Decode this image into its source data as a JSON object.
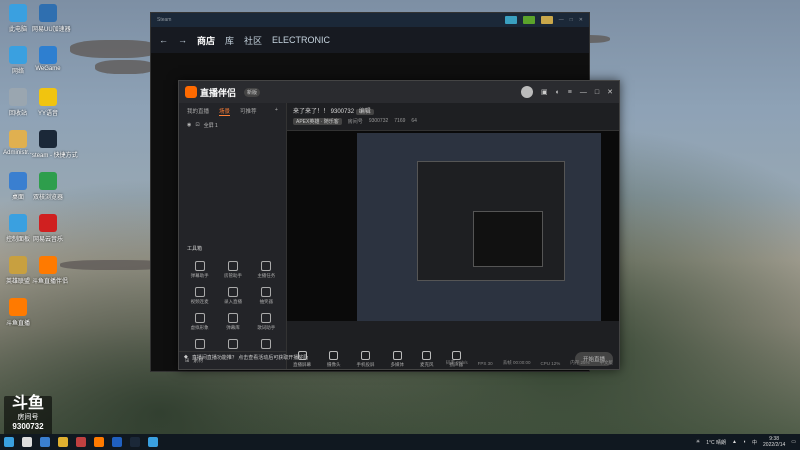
{
  "desktop": {
    "icons": [
      {
        "label": "此电脑",
        "color": "#3aa0e0"
      },
      {
        "label": "网易UU加速器",
        "color": "#2f6fb0"
      },
      {
        "label": "网络",
        "color": "#3aa0e0"
      },
      {
        "label": "WeGame",
        "color": "#2e7fd0"
      },
      {
        "label": "回收站",
        "color": "#9aa6b0"
      },
      {
        "label": "YY语音",
        "color": "#f1c40f"
      },
      {
        "label": "Administr...",
        "color": "#e0b050"
      },
      {
        "label": "steam - 快捷方式",
        "color": "#1b2838"
      },
      {
        "label": "桌面",
        "color": "#3a7fd0"
      },
      {
        "label": "双核浏览器",
        "color": "#2e9e4c"
      },
      {
        "label": "控制面板",
        "color": "#3aa0e0"
      },
      {
        "label": "网易云音乐",
        "color": "#d02020"
      },
      {
        "label": "英雄联盟",
        "color": "#c8a040"
      },
      {
        "label": "斗鱼直播伴侣",
        "color": "#ff7a00"
      },
      {
        "label": "斗鱼直播",
        "color": "#ff7a00"
      }
    ]
  },
  "steam": {
    "title": "Steam",
    "nav": [
      "商店",
      "库",
      "社区",
      "ELECTRONIC"
    ],
    "active_nav": "商店"
  },
  "app": {
    "name": "直播伴侣",
    "version": "新版",
    "tabs": [
      "我的直播",
      "场景",
      "可推荐"
    ],
    "active_tab": "场景",
    "scene": "全屏 1",
    "tools_title": "工具箱",
    "tools": [
      "弹幕助手",
      "房管助手",
      "主播任务",
      "视频连麦",
      "录入直播",
      "抽奖器",
      "虚拟形象",
      "弹幕库",
      "歌词助手",
      "",
      "",
      ""
    ],
    "room_title": "来了来了！！ 9300732",
    "room_edit": "编辑",
    "category": "APEX英雄 · 随乐客",
    "category_tag": "主播",
    "room_label": "房间号",
    "room_id": "9300732",
    "fans": "7169",
    "level": "64",
    "controls": [
      "直播屏幕",
      "摄像头",
      "手机投屏",
      "多媒体",
      "麦克风",
      "扬声器"
    ],
    "start_label": "开始直播",
    "status": [
      "码率 0Kb/s",
      "FPS 30",
      "丢帧 00:00:00",
      "CPU 12%",
      "内存 25%",
      "中文版"
    ],
    "notice": "直播间直播功能推？ 点击查看活动后可获取开播奖励",
    "bottom_label": "素材"
  },
  "room_badge": {
    "brand": "斗鱼",
    "label": "房间号",
    "number": "9300732"
  },
  "taskbar": {
    "weather": "1°C 晴朗",
    "time": "9:38",
    "date": "2022/2/14",
    "lang": "中"
  }
}
